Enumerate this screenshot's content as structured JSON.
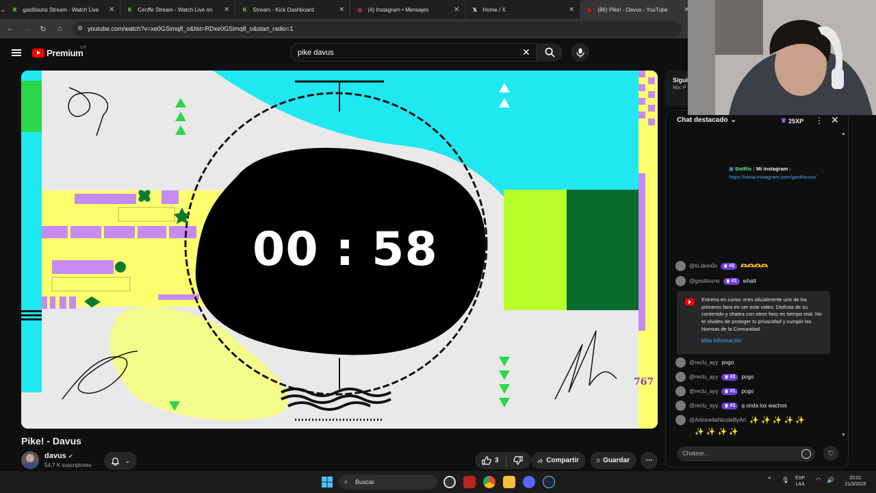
{
  "browser": {
    "tabs": [
      {
        "title": "gastilouno Stream - Watch Live",
        "icon": "kick-icon",
        "color": "#53fc18"
      },
      {
        "title": "Cenffe Stream - Watch Live on",
        "icon": "kick-icon",
        "color": "#53fc18"
      },
      {
        "title": "Stream - Kick Dashboard",
        "icon": "kick-icon",
        "color": "#53fc18"
      },
      {
        "title": "(4) Instagram • Mensajes",
        "icon": "instagram-icon",
        "color": "#e1306c"
      },
      {
        "title": "Home / X",
        "icon": "x-icon",
        "color": "#ffffff"
      },
      {
        "title": "(86) Pike! - Davus - YouTube",
        "icon": "youtube-icon",
        "color": "#ff0000"
      }
    ],
    "url": "youtube.com/watch?v=xe0GSimq8_o&list=RDxe0GSimq8_o&start_radio=1"
  },
  "youtube": {
    "logo": "Premium",
    "region": "UY",
    "search_value": "pike davus"
  },
  "video": {
    "timer": "00 : 58",
    "corner_number": "767",
    "title": "Pike! - Davus",
    "channel": "davus",
    "subscribers": "54,7 K suscriptores",
    "likes": "3",
    "share_label": "Compartir",
    "save_label": "Guardar"
  },
  "up_next": {
    "label": "Siguie",
    "sub": "Mix: P"
  },
  "chat": {
    "title": "Chat destacado",
    "xp": "25XP",
    "bot_message": {
      "user": "BotRix",
      "text": " : Mi instagram :",
      "link": "https://www.instagram.com/gastilouno/"
    },
    "messages": [
      {
        "user": "@hi.dem0n",
        "badge": "#2",
        "text": "🫶🫶🫶🫶"
      },
      {
        "user": "@gastilouno",
        "badge": "#1",
        "text": "whatt"
      }
    ],
    "notice": {
      "text": "Estreno en curso: eres oficialmente uno de los primeros fans en ver este video. Disfruta de su contenido y chatea con otros fans en tiempo real. No te olvides de proteger tu privacidad y cumplir las Normas de la Comunidad.",
      "link": "Más información"
    },
    "messages2": [
      {
        "user": "@reclu_ayy",
        "badge": "",
        "text": "pogo"
      },
      {
        "user": "@reclu_ayy",
        "badge": "#2",
        "text": "pogo"
      },
      {
        "user": "@reclu_ayy",
        "badge": "#1",
        "text": "pogo"
      },
      {
        "user": "@reclu_ayy",
        "badge": "#1",
        "text": "q onda los wachos"
      },
      {
        "user": "@AntonellaNicoleByArt",
        "badge": "",
        "text": "✨ ✨ ✨ ✨ ✨"
      }
    ],
    "overflow_line": "✨ ✨ ✨ ✨",
    "input_placeholder": "Chatear..."
  },
  "taskbar": {
    "search": "Buscar",
    "lang": "ESP",
    "lang2": "LAA",
    "time": "20:01",
    "date": "21/3/2026"
  }
}
